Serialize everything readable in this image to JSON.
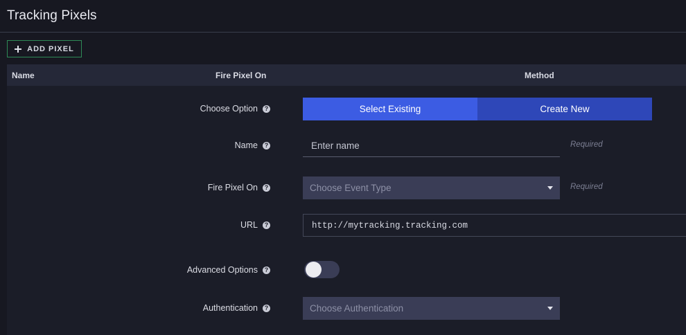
{
  "page": {
    "title": "Tracking Pixels"
  },
  "toolbar": {
    "add_label": "ADD PIXEL"
  },
  "table": {
    "columns": [
      "Name",
      "Fire Pixel On",
      "Method"
    ]
  },
  "form": {
    "choose_option": {
      "label": "Choose Option",
      "options": [
        "Select Existing",
        "Create New"
      ],
      "selected": "Select Existing"
    },
    "name": {
      "label": "Name",
      "placeholder": "Enter name",
      "required_text": "Required"
    },
    "fire_pixel_on": {
      "label": "Fire Pixel On",
      "placeholder": "Choose Event Type",
      "required_text": "Required"
    },
    "url": {
      "label": "URL",
      "value": "http://mytracking.tracking.com"
    },
    "advanced_options": {
      "label": "Advanced Options",
      "enabled": false
    },
    "authentication": {
      "label": "Authentication",
      "placeholder": "Choose Authentication"
    },
    "help_glyph": "?"
  },
  "colors": {
    "background": "#171821",
    "accent_active": "#3c5ce3",
    "accent_inactive": "#2e47b8",
    "add_border": "#2e8b57"
  }
}
